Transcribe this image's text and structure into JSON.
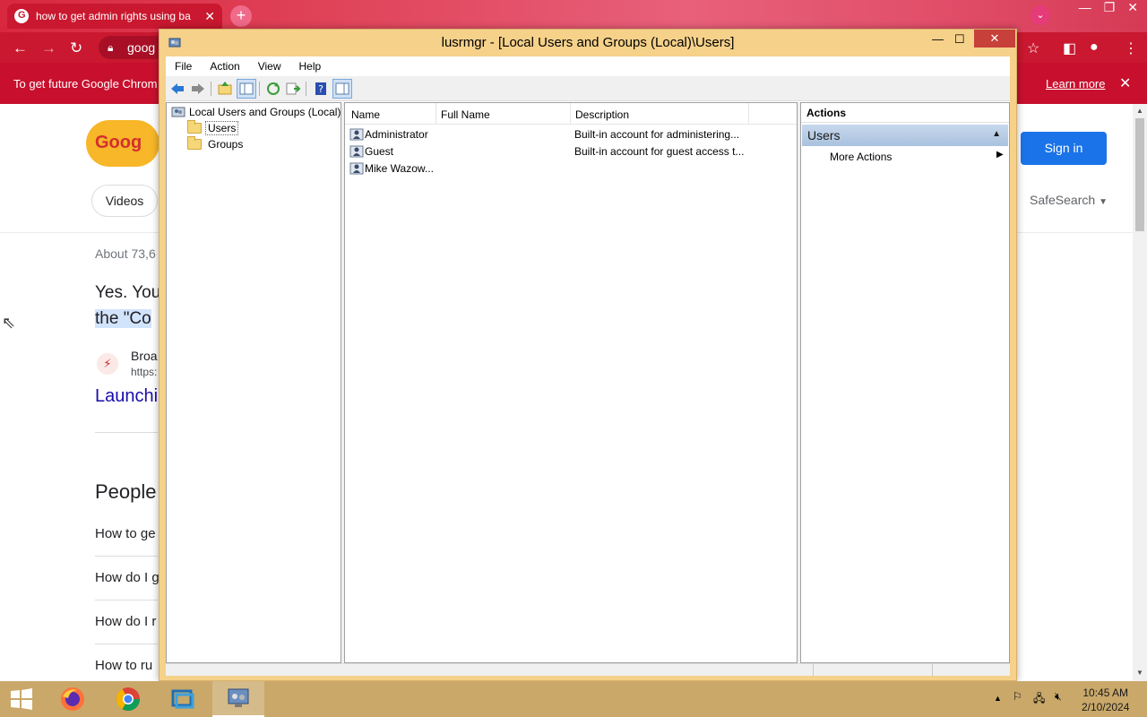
{
  "browser": {
    "tab_title": "how to get admin rights using ba",
    "tab_close": "✕",
    "newtab": "+",
    "address_partial": "goog",
    "infobar_text": "To get future Google Chrom",
    "learn_more": "Learn more",
    "infobar_close": "✕"
  },
  "google": {
    "logo_text": "Goog",
    "videos_chip": "Videos",
    "sign_in": "Sign in",
    "safesearch": "SafeSearch",
    "about": "About 73,6",
    "snippet_line1": "Yes. You",
    "snippet_line2": "the \"Co",
    "source_name": "Broa",
    "source_url": "https:",
    "result_link": "Launchi",
    "people_heading": "People",
    "paa": [
      "How to ge",
      "How do I g",
      "How do I r",
      "How to ru"
    ]
  },
  "mmc": {
    "title": "lusrmgr - [Local Users and Groups (Local)\\Users]",
    "menu": [
      "File",
      "Action",
      "View",
      "Help"
    ],
    "tree": {
      "root": "Local Users and Groups (Local)",
      "children": [
        "Users",
        "Groups"
      ]
    },
    "columns": [
      "Name",
      "Full Name",
      "Description"
    ],
    "rows": [
      {
        "name": "Administrator",
        "full_name": "",
        "description": "Built-in account for administering..."
      },
      {
        "name": "Guest",
        "full_name": "",
        "description": "Built-in account for guest access t..."
      },
      {
        "name": "Mike Wazow...",
        "full_name": "",
        "description": ""
      }
    ],
    "actions": {
      "header": "Actions",
      "group": "Users",
      "items": [
        "More Actions"
      ]
    }
  },
  "taskbar": {
    "time": "10:45 AM",
    "date": "2/10/2024"
  }
}
